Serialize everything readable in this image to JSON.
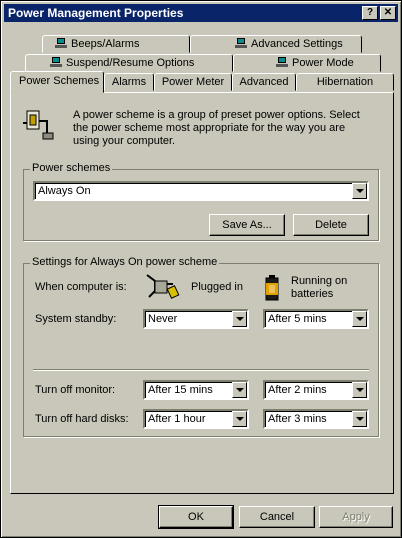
{
  "window": {
    "title": "Power Management Properties",
    "help_button": "?",
    "close_button": "✕"
  },
  "tabs": {
    "row1": [
      {
        "label": "Beeps/Alarms",
        "icon": "laptop-icon"
      },
      {
        "label": "Advanced Settings",
        "icon": "laptop-icon"
      }
    ],
    "row2": [
      {
        "label": "Suspend/Resume Options",
        "icon": "laptop-icon"
      },
      {
        "label": "Power Mode",
        "icon": "laptop-icon"
      }
    ],
    "row3": [
      {
        "label": "Power Schemes",
        "selected": true
      },
      {
        "label": "Alarms"
      },
      {
        "label": "Power Meter"
      },
      {
        "label": "Advanced"
      },
      {
        "label": "Hibernation"
      }
    ]
  },
  "intro": {
    "text": "A power scheme is a group of preset power options. Select the power scheme most appropriate for the way you are using your computer.",
    "icon": "power-scheme-icon"
  },
  "power_schemes": {
    "group_label": "Power schemes",
    "selected": "Always On",
    "save_as_label": "Save As...",
    "delete_label": "Delete"
  },
  "settings": {
    "group_label": "Settings for Always On power scheme",
    "when_label": "When computer is:",
    "plugged_in_label": "Plugged in",
    "batteries_label": "Running on batteries",
    "rows": [
      {
        "label": "System standby:",
        "plugged": "Never",
        "battery": "After 5 mins"
      },
      {
        "label": "Turn off monitor:",
        "plugged": "After 15 mins",
        "battery": "After 2 mins"
      },
      {
        "label": "Turn off hard disks:",
        "plugged": "After 1 hour",
        "battery": "After 3 mins"
      }
    ]
  },
  "footer": {
    "ok_label": "OK",
    "cancel_label": "Cancel",
    "apply_label": "Apply"
  },
  "colors": {
    "face": "#c8c7b9",
    "titlebar": "#0a246a"
  }
}
